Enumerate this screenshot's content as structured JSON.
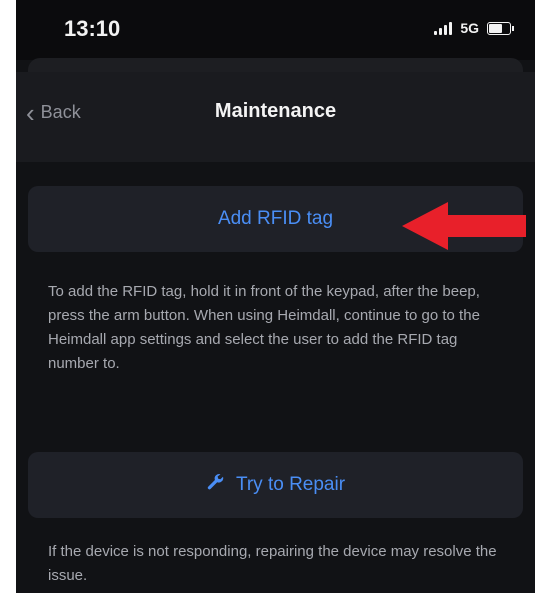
{
  "status_bar": {
    "time": "13:10",
    "network": "5G"
  },
  "nav": {
    "back_label": "Back",
    "title": "Maintenance"
  },
  "sections": [
    {
      "button_label": "Add RFID tag",
      "description": "To add the RFID tag, hold it in front of the keypad, after the beep, press the arm button. When using Heimdall, continue to go to the Heimdall app settings and select the user to add the RFID tag number to."
    },
    {
      "button_label": "Try to Repair",
      "icon": "wrench-icon",
      "description": "If the device is not responding, repairing the device may resolve the issue."
    }
  ],
  "colors": {
    "accent": "#4a8ef5",
    "background": "#111215",
    "card": "#1f2128",
    "annotation_arrow": "#e8202a"
  }
}
